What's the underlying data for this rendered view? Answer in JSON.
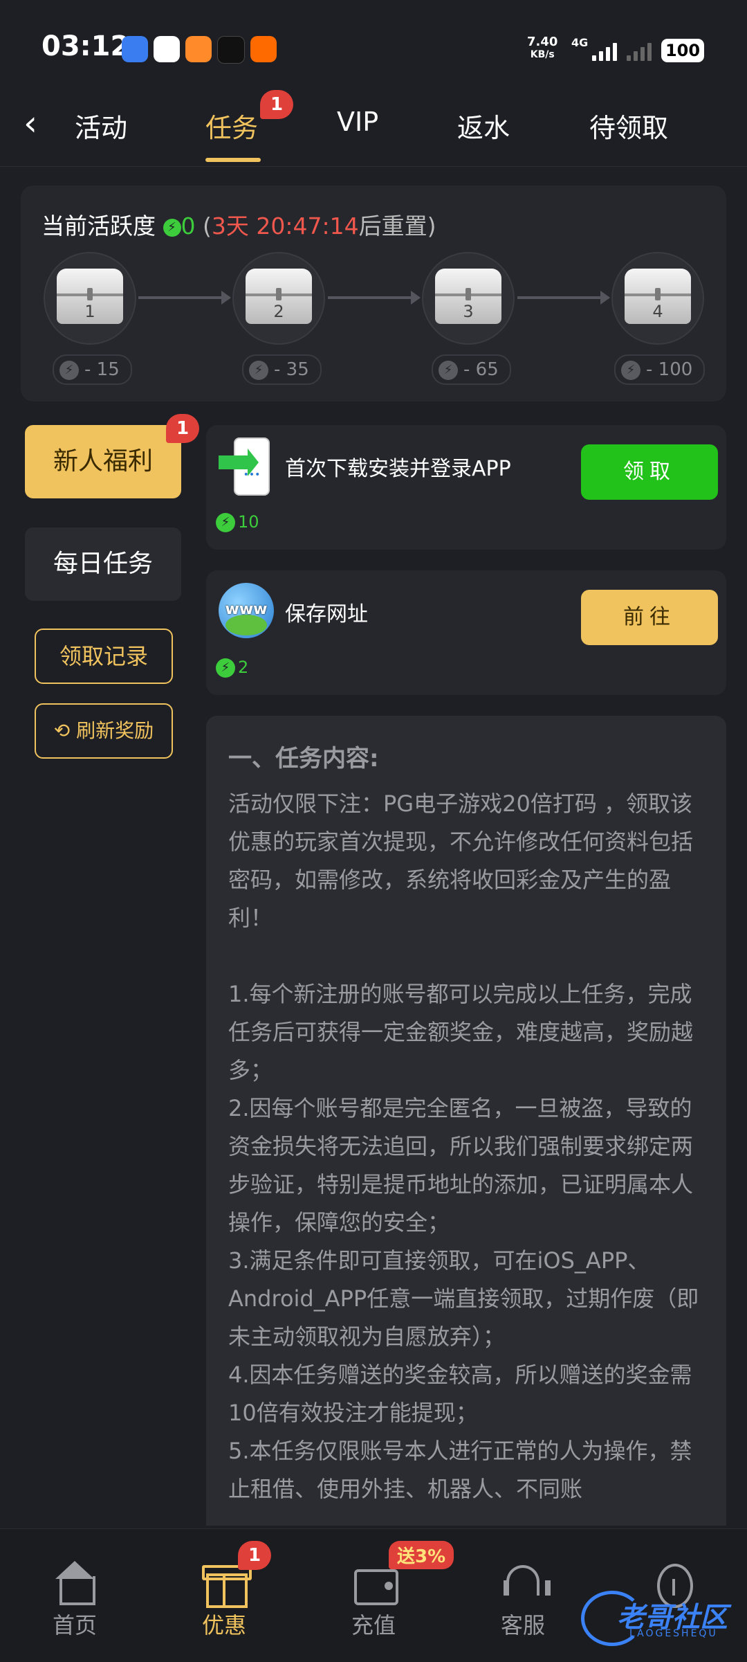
{
  "status_bar": {
    "time": "03:12",
    "net_speed": "7.40",
    "net_unit": "KB/s",
    "network": "4G",
    "battery": "100"
  },
  "tabs": [
    {
      "label": "活动"
    },
    {
      "label": "任务",
      "badge": "1",
      "active": true
    },
    {
      "label": "VIP"
    },
    {
      "label": "返水"
    },
    {
      "label": "待领取"
    }
  ],
  "activity": {
    "title": "当前活跃度",
    "value": "0",
    "paren_open": "(",
    "reset_time": "3天 20:47:14",
    "reset_suffix": "后重置",
    "paren_close": ")",
    "chests": [
      {
        "label": "1",
        "requirement": "- 15"
      },
      {
        "label": "2",
        "requirement": "- 35"
      },
      {
        "label": "3",
        "requirement": "- 65"
      },
      {
        "label": "4",
        "requirement": "- 100"
      }
    ]
  },
  "side_menu": {
    "newbie": "新人福利",
    "newbie_badge": "1",
    "daily": "每日任务",
    "record": "领取记录",
    "refresh": "刷新奖励"
  },
  "tasks": [
    {
      "title": "首次下载安装并登录APP",
      "reward": "10",
      "button": "领取",
      "icon": "phone-download-icon"
    },
    {
      "title": "保存网址",
      "reward": "2",
      "button": "前往",
      "icon": "www-globe-icon",
      "icon_text": "www"
    }
  ],
  "content": {
    "heading": "一、任务内容:",
    "intro": "活动仅限下注：PG电子游戏20倍打码 ，领取该优惠的玩家首次提现，不允许修改任何资料包括密码，如需修改，系统将收回彩金及产生的盈利！",
    "rules": [
      "1.每个新注册的账号都可以完成以上任务，完成任务后可获得一定金额奖金，难度越高，奖励越多；",
      "2.因每个账号都是完全匿名，一旦被盗，导致的资金损失将无法追回，所以我们强制要求绑定两步验证，特别是提币地址的添加，已证明属本人操作，保障您的安全；",
      "3.满足条件即可直接领取，可在iOS_APP、Android_APP任意一端直接领取，过期作废（即未主动领取视为自愿放弃）；",
      "4.因本任务赠送的奖金较高，所以赠送的奖金需10倍有效投注才能提现；",
      "5.本任务仅限账号本人进行正常的人为操作，禁止租借、使用外挂、机器人、不同账"
    ]
  },
  "bottom_nav": [
    {
      "label": "首页",
      "icon": "home-icon"
    },
    {
      "label": "优惠",
      "icon": "gift-icon",
      "badge": "1",
      "active": true
    },
    {
      "label": "充值",
      "icon": "wallet-icon",
      "badge": "送3%"
    },
    {
      "label": "客服",
      "icon": "headset-icon"
    },
    {
      "label": "",
      "icon": "profile-icon"
    }
  ],
  "watermark": {
    "text": "老哥社区",
    "sub": "LAOGESHEQU"
  },
  "colors": {
    "background": "#1e1f24",
    "card": "#26272d",
    "accent": "#f0c35e",
    "green": "#22c21a",
    "red": "#e0403a",
    "countdown": "#f0574d"
  }
}
